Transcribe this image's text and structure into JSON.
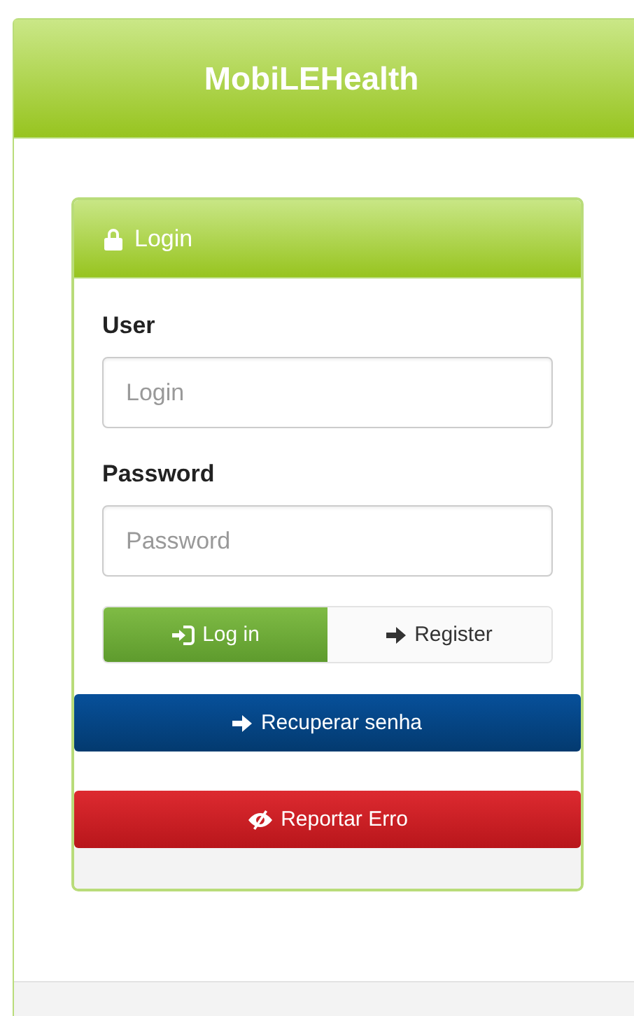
{
  "app": {
    "title": "MobiLEHealth"
  },
  "login_panel": {
    "title": "Login",
    "fields": [
      {
        "label": "User",
        "placeholder": "Login"
      },
      {
        "label": "Password",
        "placeholder": "Password"
      }
    ],
    "mode_buttons": [
      {
        "label": "Log in",
        "selected": true
      },
      {
        "label": "Register",
        "selected": false
      }
    ],
    "actions": [
      {
        "label": "Recuperar senha",
        "kind": "primary"
      },
      {
        "label": "Reportar Erro",
        "kind": "danger"
      }
    ]
  }
}
